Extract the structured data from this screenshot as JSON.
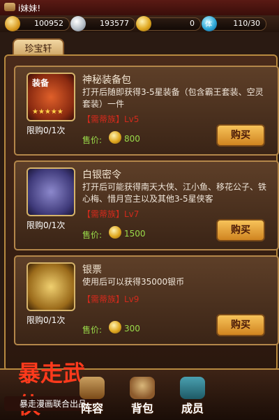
{
  "ticker": {
    "message": "i妹妹!"
  },
  "resources": {
    "gold": "100952",
    "silver": "193577",
    "yuanbao": "0",
    "stamina": "110/30"
  },
  "tab": {
    "label": "珍宝轩"
  },
  "items": [
    {
      "title": "神秘装备包",
      "desc": "打开后随即获得3-5星装备（包含霸王套装、空灵套装）一件",
      "vip": "【需蒂族】Lv5",
      "limit": "限购0/1次",
      "price_label": "售价:",
      "price": "800",
      "buy_label": "购买",
      "icon_text": "装备",
      "stars": "★★★★★"
    },
    {
      "title": "白银密令",
      "desc": "打开后可能获得南天大侠、江小鱼、移花公子、铁心梅、惜月宫主以及其他3-5星侠客",
      "vip": "【需蒂族】Lv7",
      "limit": "限购0/1次",
      "price_label": "售价:",
      "price": "1500",
      "buy_label": "购买"
    },
    {
      "title": "银票",
      "desc": "使用后可以获得35000银币",
      "vip": "【需蒂族】Lv9",
      "limit": "限购0/1次",
      "price_label": "售价:",
      "price": "300",
      "buy_label": "购买"
    }
  ],
  "footer": {
    "logo_text": "暴走武侠",
    "logo_sub": "暴走漫画联合出品",
    "nav": [
      "阵容",
      "背包",
      "成员"
    ]
  }
}
